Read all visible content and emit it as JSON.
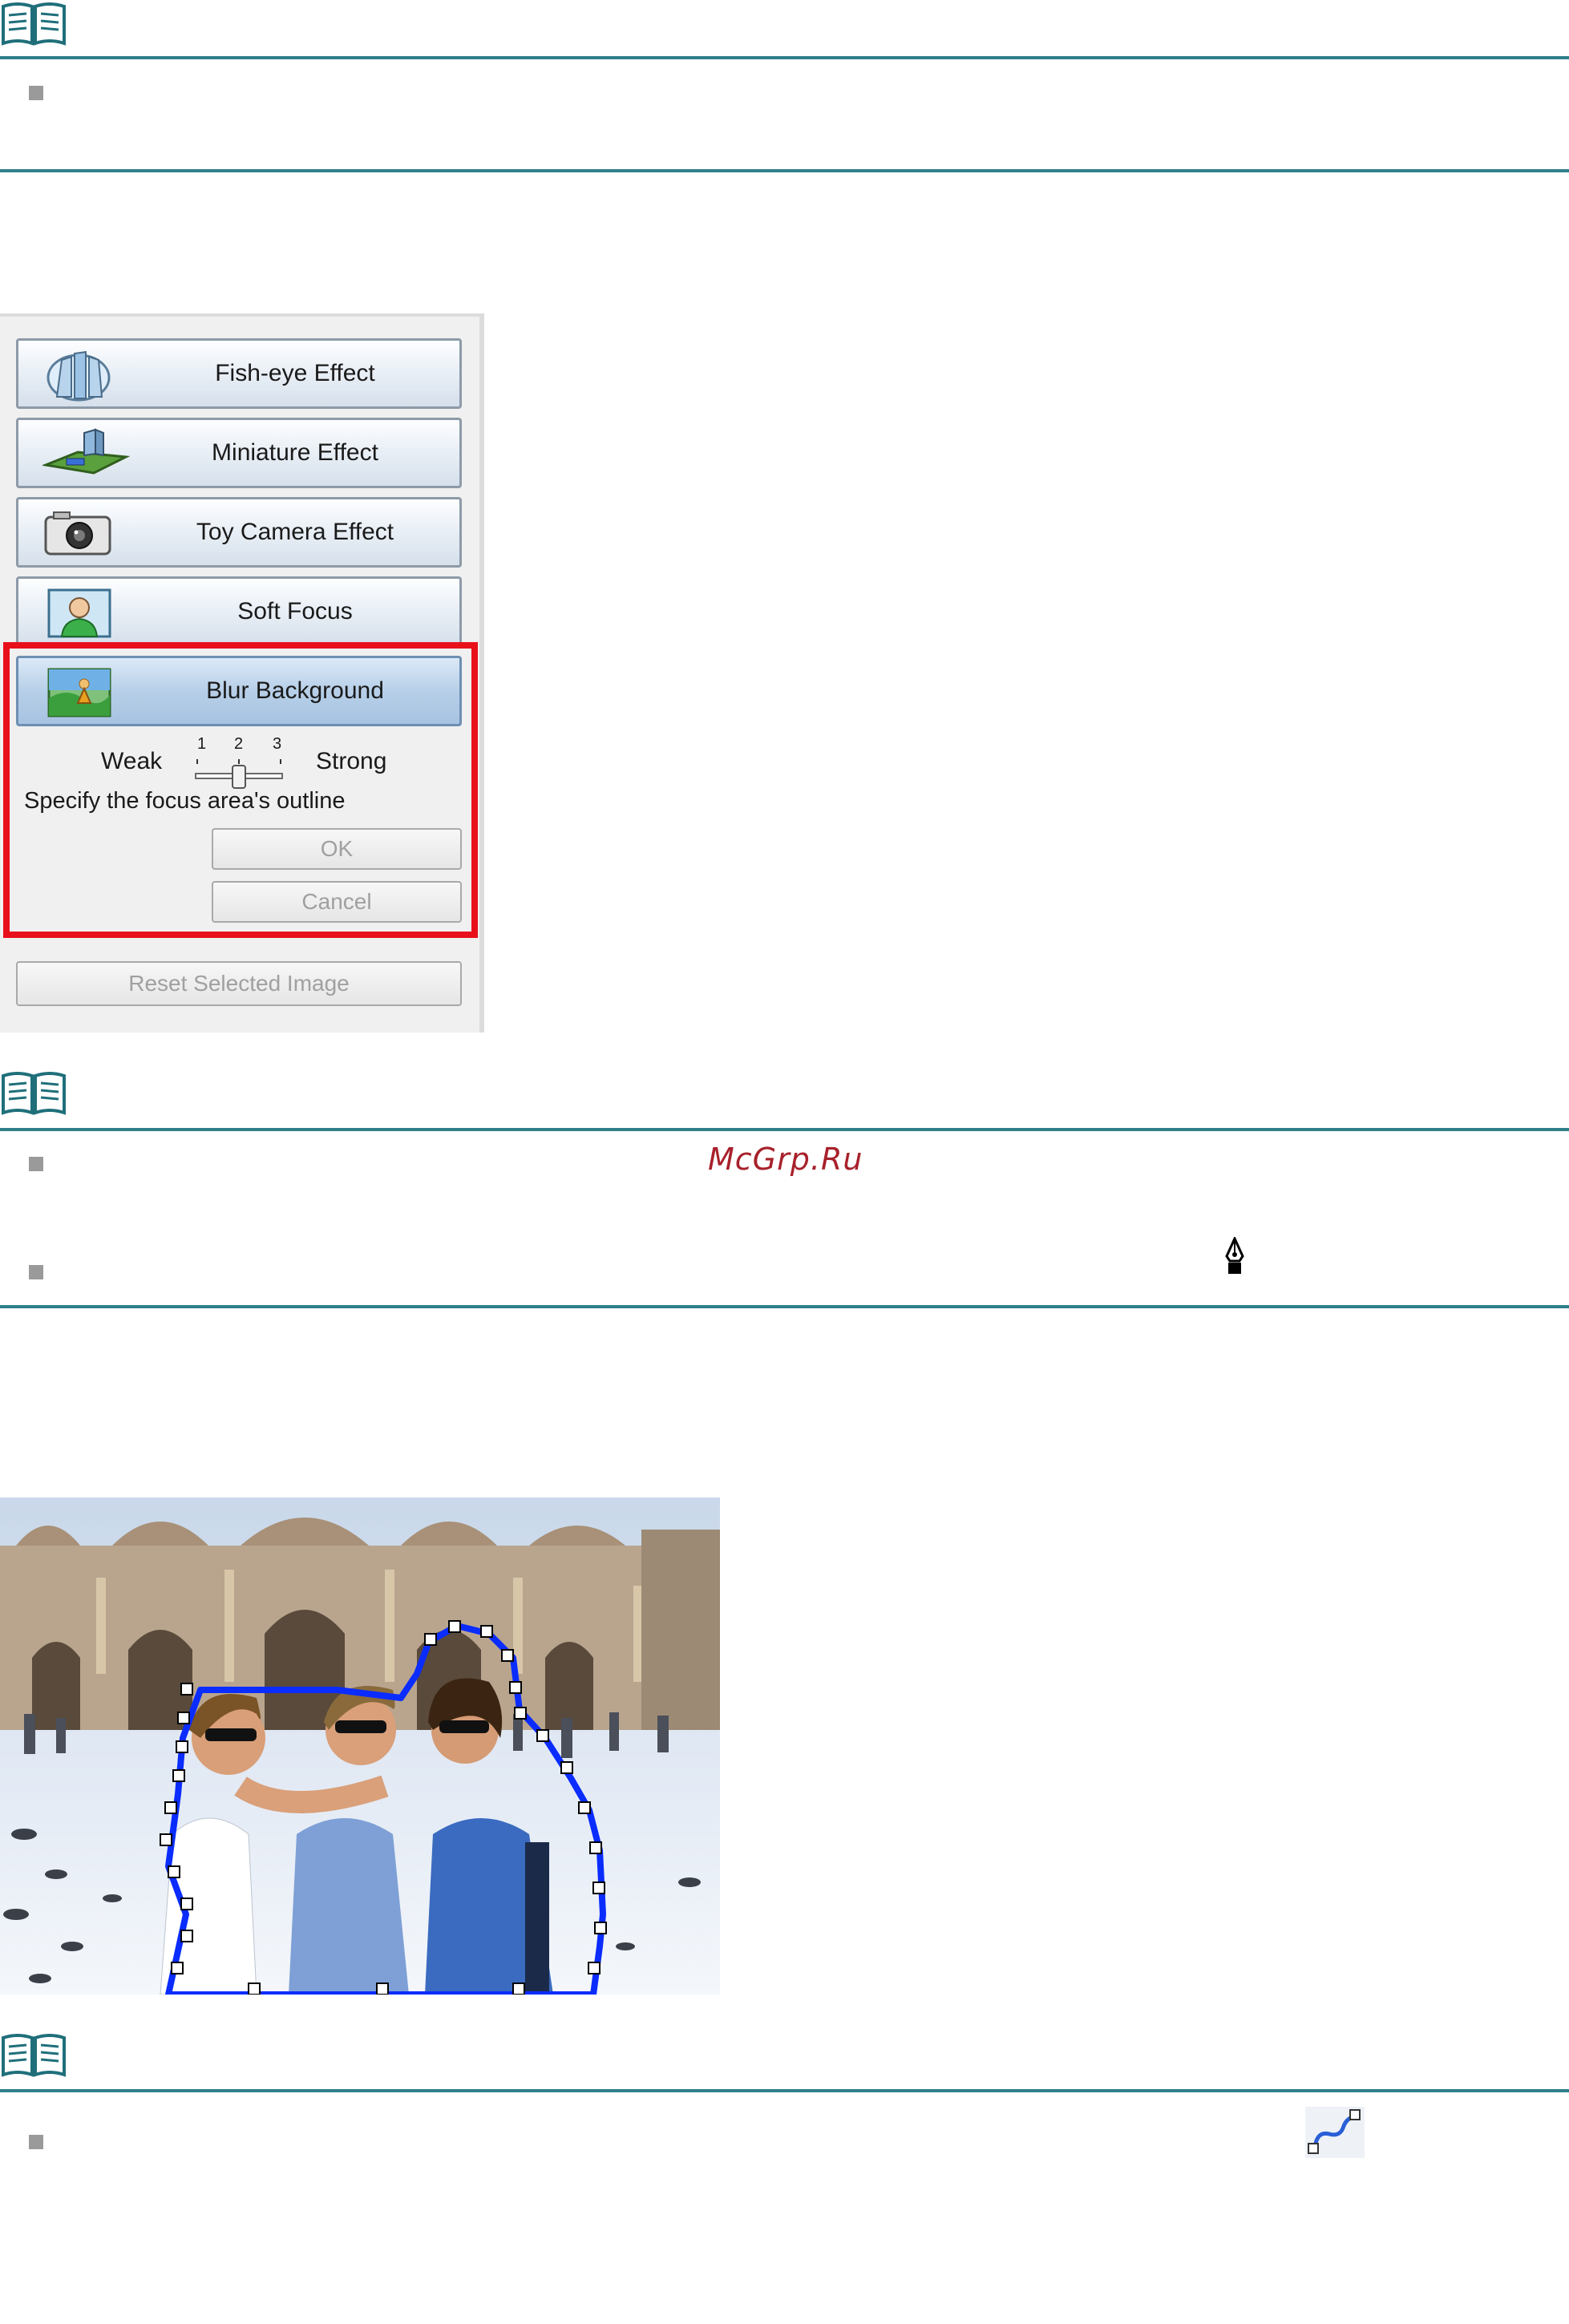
{
  "effects_panel": {
    "buttons": [
      {
        "label": "Fish-eye Effect",
        "icon": "fish-eye-icon"
      },
      {
        "label": "Miniature Effect",
        "icon": "miniature-icon"
      },
      {
        "label": "Toy Camera Effect",
        "icon": "toy-camera-icon"
      },
      {
        "label": "Soft Focus",
        "icon": "soft-focus-icon"
      },
      {
        "label": "Blur Background",
        "icon": "blur-background-icon"
      }
    ],
    "slider": {
      "weak_label": "Weak",
      "strong_label": "Strong",
      "ticks": [
        "1",
        "2",
        "3"
      ],
      "value": 2
    },
    "instruction": "Specify the focus area's outline",
    "ok_label": "OK",
    "cancel_label": "Cancel",
    "reset_label": "Reset Selected Image"
  },
  "watermark": "McGrp.Ru",
  "colors": {
    "rule": "#2f7f8a",
    "highlight": "#e8111b",
    "outline": "#0a2cff"
  },
  "icons": [
    "note-icon",
    "pen-cursor-icon",
    "outline-tool-icon"
  ]
}
